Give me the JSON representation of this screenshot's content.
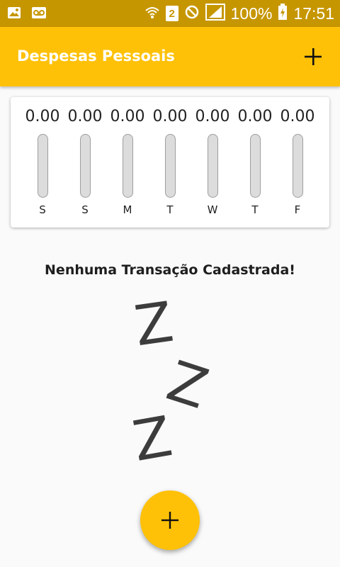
{
  "status_bar": {
    "battery": "100%",
    "time": "17:51",
    "sim_label": "2"
  },
  "app_bar": {
    "title": "Despesas Pessoais",
    "add_icon": "plus-icon"
  },
  "chart": {
    "bars": [
      {
        "value": "0.00",
        "day": "S",
        "fill": 0
      },
      {
        "value": "0.00",
        "day": "S",
        "fill": 0
      },
      {
        "value": "0.00",
        "day": "M",
        "fill": 0
      },
      {
        "value": "0.00",
        "day": "T",
        "fill": 0
      },
      {
        "value": "0.00",
        "day": "W",
        "fill": 0
      },
      {
        "value": "0.00",
        "day": "T",
        "fill": 0
      },
      {
        "value": "0.00",
        "day": "F",
        "fill": 0
      }
    ]
  },
  "empty_state": {
    "message": "Nenhuma Transação Cadastrada!",
    "image": "zzz-sleep-image"
  },
  "fab": {
    "icon": "plus-icon"
  },
  "colors": {
    "accent": "#ffc107",
    "status_bar": "#c69600",
    "background": "#fafafa"
  }
}
